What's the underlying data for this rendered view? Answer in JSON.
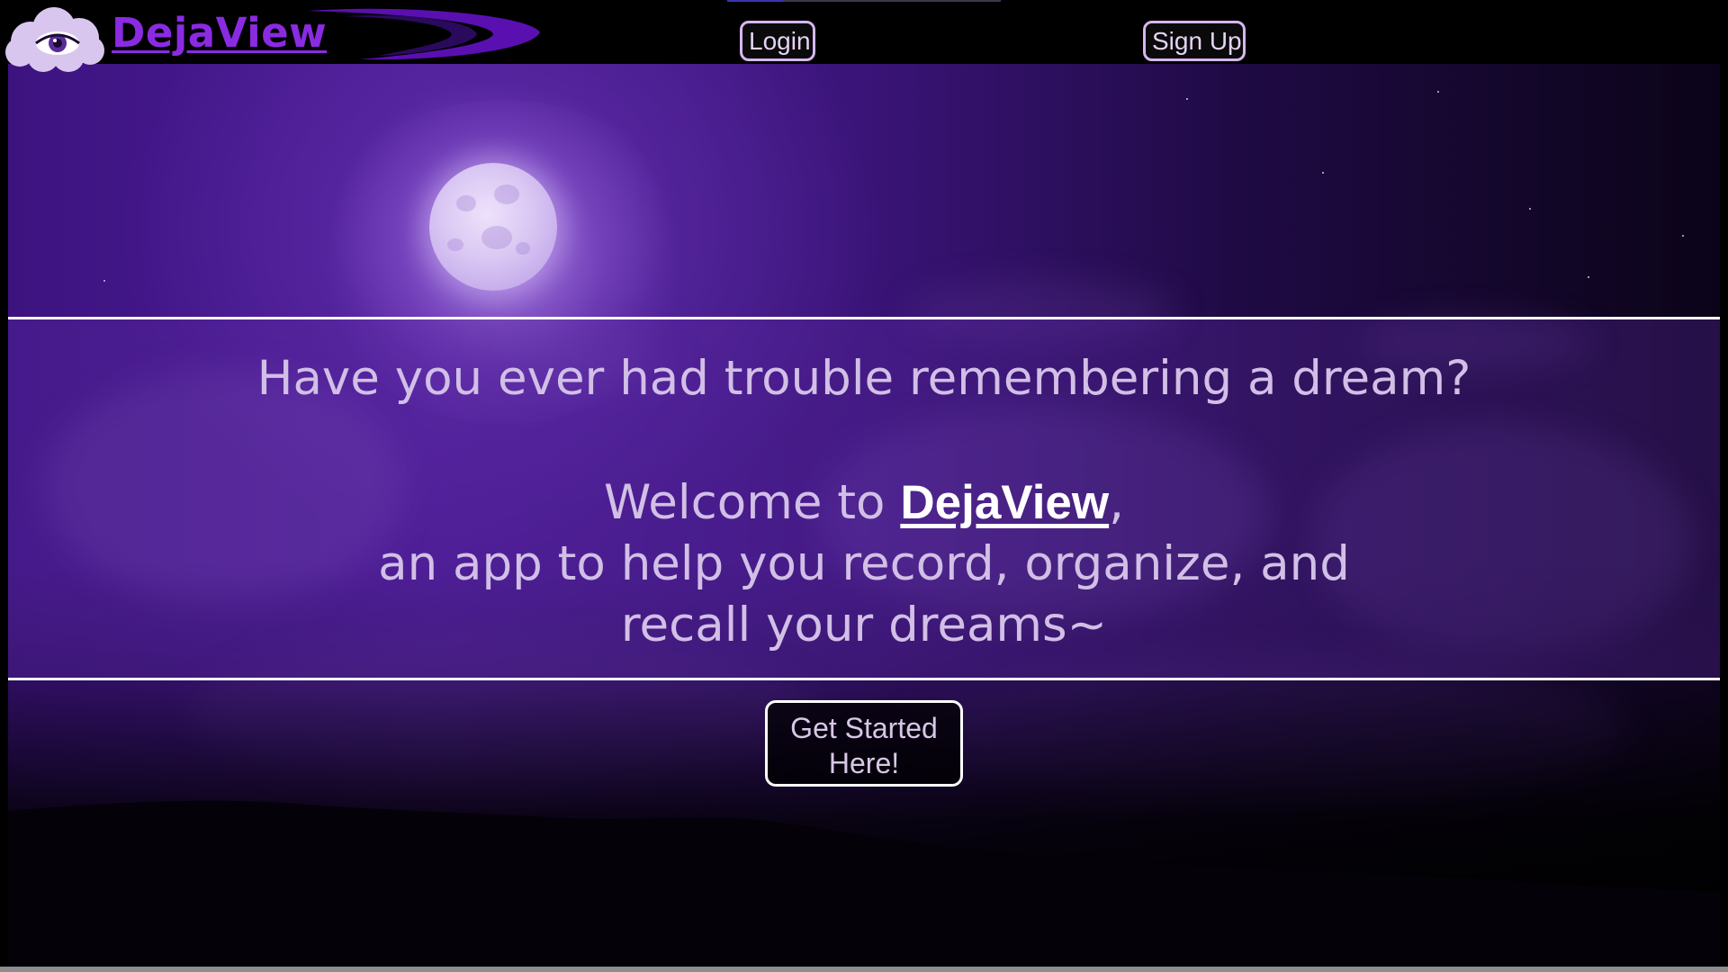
{
  "header": {
    "brand": "DejaView",
    "login_label": "Login",
    "signup_label": "Sign Up"
  },
  "hero": {
    "question": "Have you ever had trouble remembering a dream?",
    "welcome_prefix": "Welcome to ",
    "welcome_brand": "DejaView",
    "welcome_suffix": ",",
    "tagline_line1": "an app to help you record, organize, and",
    "tagline_line2": "recall your dreams~"
  },
  "cta": {
    "line1": "Get Started",
    "line2": "Here!"
  },
  "colors": {
    "brand": "#8a2be2",
    "button_border": "#d6b6f0",
    "sky_purple": "#4a1b94",
    "banner_border": "#ffffff",
    "text_lavender": "#d2bfe6"
  },
  "icons": {
    "logo": "eye-cloud-icon",
    "decoration": "swoosh-icon"
  }
}
